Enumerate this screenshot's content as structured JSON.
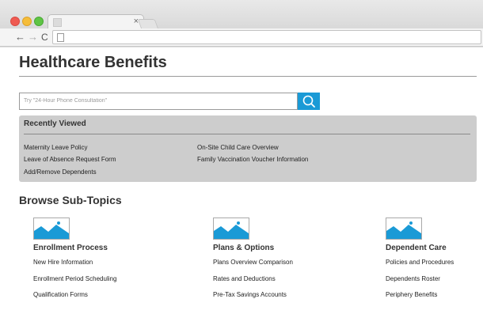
{
  "browser": {
    "tab_close": "×"
  },
  "page": {
    "title": "Healthcare Benefits"
  },
  "search": {
    "placeholder": "Try \"24-Hour Phone Consultation\""
  },
  "recently_viewed": {
    "title": "Recently Viewed",
    "links": [
      "Maternity Leave Policy",
      "Leave of Absence Request Form",
      "Add/Remove Dependents",
      "On-Site Child Care Overview",
      "Family Vaccination Voucher Information"
    ]
  },
  "browse": {
    "title": "Browse Sub-Topics",
    "categories": [
      {
        "title": "Enrollment Process",
        "links": [
          "New Hire Information",
          "Enrollment Period Scheduling",
          "Qualification Forms"
        ]
      },
      {
        "title": "Plans & Options",
        "links": [
          "Plans Overview Comparison",
          "Rates and Deductions",
          "Pre-Tax Savings Accounts"
        ]
      },
      {
        "title": "Dependent Care",
        "links": [
          "Policies and Procedures",
          "Dependents Roster",
          "Periphery Benefits"
        ]
      }
    ]
  },
  "colors": {
    "accent": "#1a9ad6",
    "panel": "#cdcdcd"
  },
  "icons": {
    "search": "search-icon",
    "thumbnail": "image-placeholder-icon"
  }
}
